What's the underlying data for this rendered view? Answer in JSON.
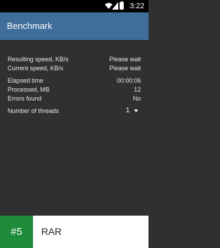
{
  "statusbar": {
    "time": "3:22"
  },
  "appbar": {
    "title": "Benchmark"
  },
  "stats": [
    {
      "label": "Resulting speed, KB/s",
      "value": "Please wait"
    },
    {
      "label": "Current speed, KB/s",
      "value": "Please wait"
    },
    {
      "label": "Elapsed time",
      "value": "00:00:06"
    },
    {
      "label": "Processed, MB",
      "value": "12"
    },
    {
      "label": "Errors found",
      "value": "No"
    }
  ],
  "threads": {
    "label": "Number of threads",
    "value": "1"
  },
  "banner": {
    "rank": "#5",
    "app_name": "RAR"
  }
}
